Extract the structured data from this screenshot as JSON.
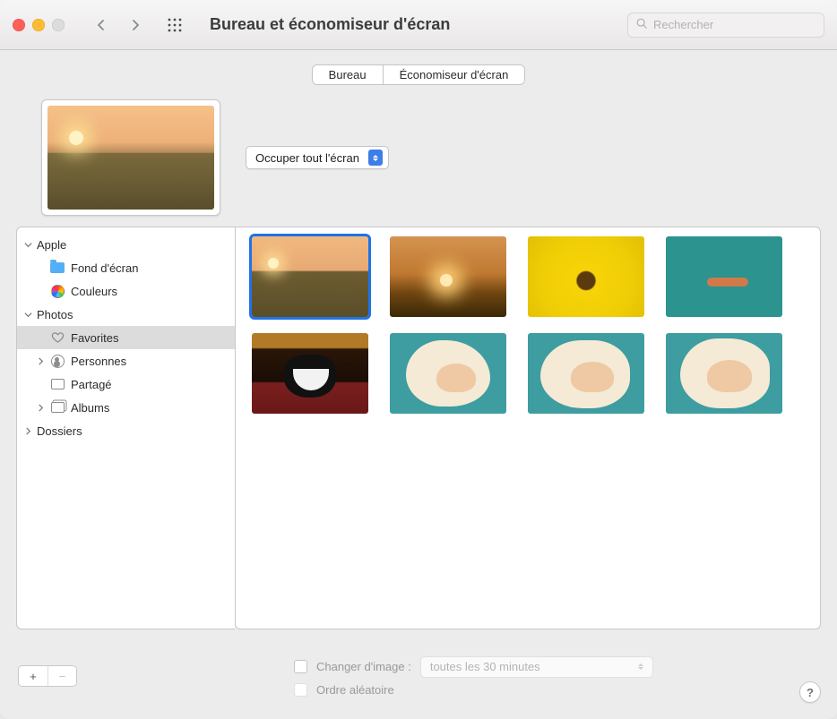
{
  "window": {
    "title": "Bureau et économiseur d'écran"
  },
  "search": {
    "placeholder": "Rechercher"
  },
  "tabs": {
    "desktop": "Bureau",
    "screensaver": "Économiseur d'écran"
  },
  "fit": {
    "label": "Occuper tout l'écran"
  },
  "sidebar": {
    "apple": {
      "label": "Apple",
      "wallpaper": "Fond d'écran",
      "colors": "Couleurs"
    },
    "photos": {
      "label": "Photos",
      "favorites": "Favorites",
      "people": "Personnes",
      "shared": "Partagé",
      "albums": "Albums"
    },
    "folders": {
      "label": "Dossiers"
    }
  },
  "options": {
    "change_label": "Changer d'image :",
    "interval": "toutes les 30 minutes",
    "random_label": "Ordre aléatoire"
  },
  "help": {
    "symbol": "?"
  },
  "add_remove": {
    "plus": "+",
    "minus": "−"
  }
}
